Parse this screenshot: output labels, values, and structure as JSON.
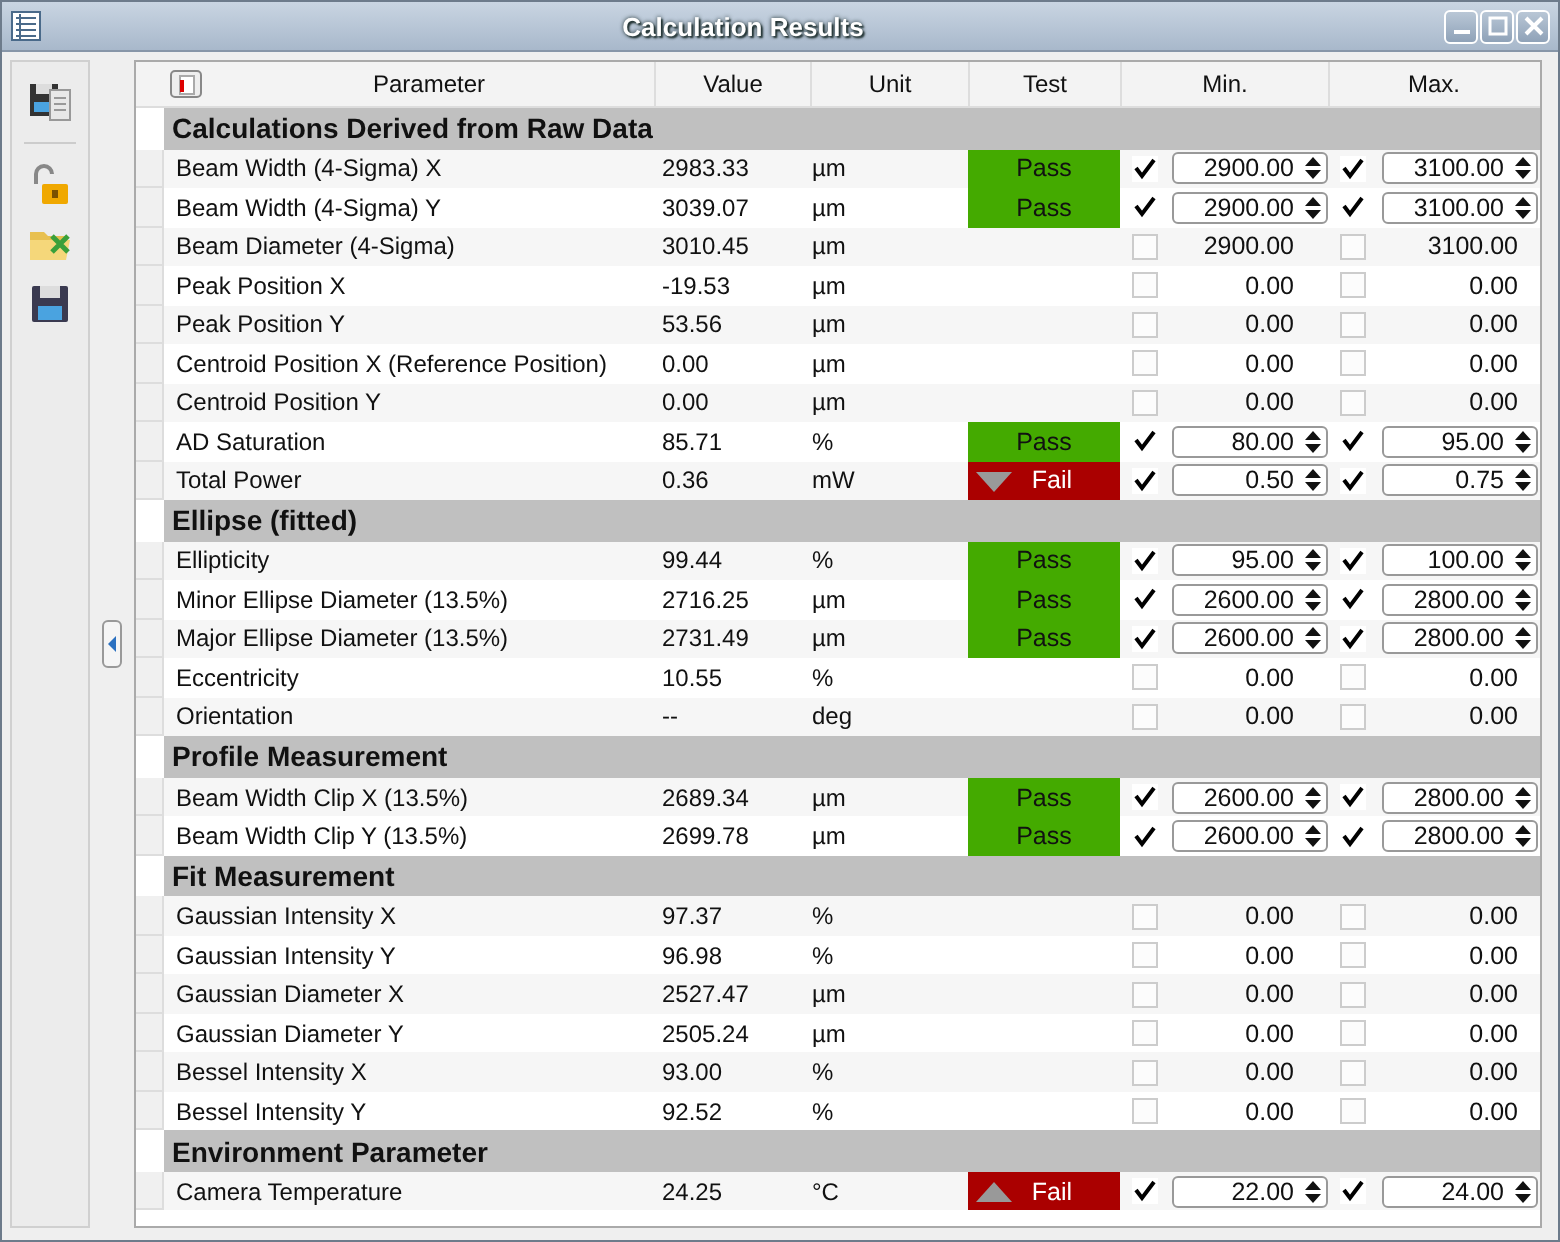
{
  "window": {
    "title": "Calculation Results"
  },
  "table": {
    "columns": [
      "Parameter",
      "Value",
      "Unit",
      "Test",
      "Min.",
      "Max."
    ],
    "sections": [
      {
        "title": "Calculations Derived from Raw Data",
        "rows": [
          {
            "parameter": "Beam Width (4-Sigma) X",
            "value": "2983.33",
            "unit": "µm",
            "test": {
              "label": "Pass",
              "kind": "pass"
            },
            "min": {
              "checked": true,
              "value": "2900.00"
            },
            "max": {
              "checked": true,
              "value": "3100.00"
            }
          },
          {
            "parameter": "Beam Width (4-Sigma) Y",
            "value": "3039.07",
            "unit": "µm",
            "test": {
              "label": "Pass",
              "kind": "pass"
            },
            "min": {
              "checked": true,
              "value": "2900.00"
            },
            "max": {
              "checked": true,
              "value": "3100.00"
            }
          },
          {
            "parameter": "Beam Diameter (4-Sigma)",
            "value": "3010.45",
            "unit": "µm",
            "min": {
              "checked": false,
              "value": "2900.00"
            },
            "max": {
              "checked": false,
              "value": "3100.00"
            }
          },
          {
            "parameter": "Peak Position X",
            "value": "-19.53",
            "unit": "µm",
            "min": {
              "checked": false,
              "value": "0.00"
            },
            "max": {
              "checked": false,
              "value": "0.00"
            }
          },
          {
            "parameter": "Peak Position Y",
            "value": "53.56",
            "unit": "µm",
            "min": {
              "checked": false,
              "value": "0.00"
            },
            "max": {
              "checked": false,
              "value": "0.00"
            }
          },
          {
            "parameter": "Centroid Position X (Reference Position)",
            "value": "0.00",
            "unit": "µm",
            "min": {
              "checked": false,
              "value": "0.00"
            },
            "max": {
              "checked": false,
              "value": "0.00"
            }
          },
          {
            "parameter": "Centroid Position Y",
            "value": "0.00",
            "unit": "µm",
            "min": {
              "checked": false,
              "value": "0.00"
            },
            "max": {
              "checked": false,
              "value": "0.00"
            }
          },
          {
            "parameter": "AD Saturation",
            "value": "85.71",
            "unit": "%",
            "test": {
              "label": "Pass",
              "kind": "pass"
            },
            "min": {
              "checked": true,
              "value": "80.00"
            },
            "max": {
              "checked": true,
              "value": "95.00"
            }
          },
          {
            "parameter": "Total Power",
            "value": "0.36",
            "unit": "mW",
            "test": {
              "label": "Fail",
              "kind": "fail-below"
            },
            "min": {
              "checked": true,
              "value": "0.50"
            },
            "max": {
              "checked": true,
              "value": "0.75"
            }
          }
        ]
      },
      {
        "title": "Ellipse (fitted)",
        "rows": [
          {
            "parameter": "Ellipticity",
            "value": "99.44",
            "unit": "%",
            "test": {
              "label": "Pass",
              "kind": "pass"
            },
            "min": {
              "checked": true,
              "value": "95.00"
            },
            "max": {
              "checked": true,
              "value": "100.00"
            }
          },
          {
            "parameter": "Minor Ellipse Diameter (13.5%)",
            "value": "2716.25",
            "unit": "µm",
            "test": {
              "label": "Pass",
              "kind": "pass"
            },
            "min": {
              "checked": true,
              "value": "2600.00"
            },
            "max": {
              "checked": true,
              "value": "2800.00"
            }
          },
          {
            "parameter": "Major Ellipse Diameter (13.5%)",
            "value": "2731.49",
            "unit": "µm",
            "test": {
              "label": "Pass",
              "kind": "pass"
            },
            "min": {
              "checked": true,
              "value": "2600.00"
            },
            "max": {
              "checked": true,
              "value": "2800.00"
            }
          },
          {
            "parameter": "Eccentricity",
            "value": "10.55",
            "unit": "%",
            "min": {
              "checked": false,
              "value": "0.00"
            },
            "max": {
              "checked": false,
              "value": "0.00"
            }
          },
          {
            "parameter": "Orientation",
            "value": "--",
            "unit": "deg",
            "min": {
              "checked": false,
              "value": "0.00"
            },
            "max": {
              "checked": false,
              "value": "0.00"
            }
          }
        ]
      },
      {
        "title": "Profile Measurement",
        "rows": [
          {
            "parameter": "Beam Width Clip X (13.5%)",
            "value": "2689.34",
            "unit": "µm",
            "test": {
              "label": "Pass",
              "kind": "pass"
            },
            "min": {
              "checked": true,
              "value": "2600.00"
            },
            "max": {
              "checked": true,
              "value": "2800.00"
            }
          },
          {
            "parameter": "Beam Width Clip Y (13.5%)",
            "value": "2699.78",
            "unit": "µm",
            "test": {
              "label": "Pass",
              "kind": "pass"
            },
            "min": {
              "checked": true,
              "value": "2600.00"
            },
            "max": {
              "checked": true,
              "value": "2800.00"
            }
          }
        ]
      },
      {
        "title": "Fit Measurement",
        "rows": [
          {
            "parameter": "Gaussian Intensity X",
            "value": "97.37",
            "unit": "%",
            "min": {
              "checked": false,
              "value": "0.00"
            },
            "max": {
              "checked": false,
              "value": "0.00"
            }
          },
          {
            "parameter": "Gaussian Intensity Y",
            "value": "96.98",
            "unit": "%",
            "min": {
              "checked": false,
              "value": "0.00"
            },
            "max": {
              "checked": false,
              "value": "0.00"
            }
          },
          {
            "parameter": "Gaussian Diameter X",
            "value": "2527.47",
            "unit": "µm",
            "min": {
              "checked": false,
              "value": "0.00"
            },
            "max": {
              "checked": false,
              "value": "0.00"
            }
          },
          {
            "parameter": "Gaussian Diameter Y",
            "value": "2505.24",
            "unit": "µm",
            "min": {
              "checked": false,
              "value": "0.00"
            },
            "max": {
              "checked": false,
              "value": "0.00"
            }
          },
          {
            "parameter": "Bessel Intensity X",
            "value": "93.00",
            "unit": "%",
            "min": {
              "checked": false,
              "value": "0.00"
            },
            "max": {
              "checked": false,
              "value": "0.00"
            }
          },
          {
            "parameter": "Bessel Intensity Y",
            "value": "92.52",
            "unit": "%",
            "min": {
              "checked": false,
              "value": "0.00"
            },
            "max": {
              "checked": false,
              "value": "0.00"
            }
          }
        ]
      },
      {
        "title": "Environment Parameter",
        "rows": [
          {
            "parameter": "Camera Temperature",
            "value": "24.25",
            "unit": "°C",
            "test": {
              "label": "Fail",
              "kind": "fail-above"
            },
            "min": {
              "checked": true,
              "value": "22.00"
            },
            "max": {
              "checked": true,
              "value": "24.00"
            }
          }
        ]
      }
    ]
  }
}
